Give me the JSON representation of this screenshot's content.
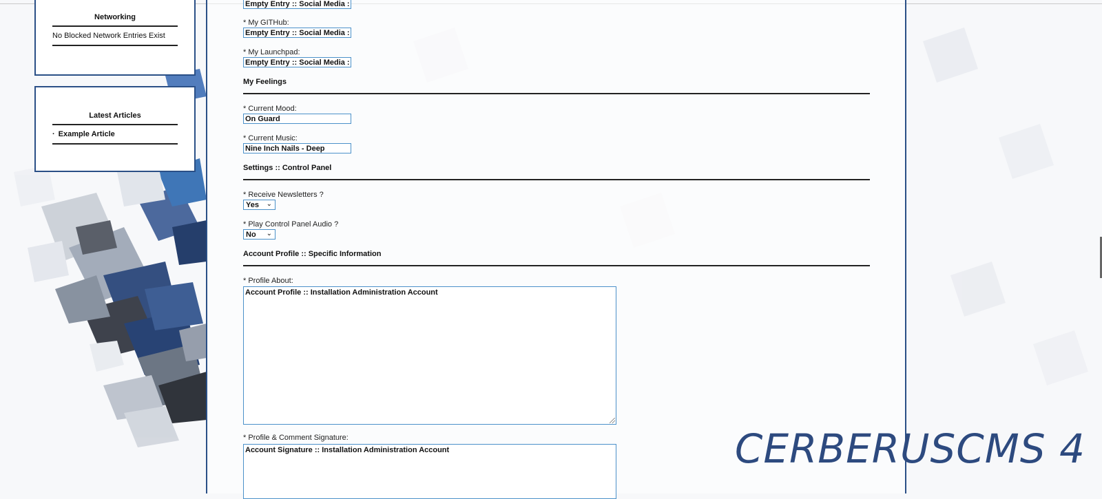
{
  "sidebar": {
    "networking": {
      "title": "Networking",
      "entry": "No Blocked Network Entries Exist"
    },
    "articles": {
      "title": "Latest Articles",
      "items": [
        {
          "bullet": "·",
          "label": "Example Article"
        }
      ]
    }
  },
  "form": {
    "social_prev": {
      "value": "Empty Entry :: Social Media :"
    },
    "github": {
      "label": "* My GITHub:",
      "value": "Empty Entry :: Social Media :"
    },
    "launchpad": {
      "label": "* My Launchpad:",
      "value": "Empty Entry :: Social Media :"
    },
    "feelings_title": "My Feelings",
    "mood": {
      "label": "* Current Mood:",
      "value": "On Guard"
    },
    "music": {
      "label": "* Current Music:",
      "value": "Nine Inch Nails - Deep"
    },
    "settings_title": "Settings :: Control Panel",
    "newsletters": {
      "label": "* Receive Newsletters ?",
      "value": "Yes"
    },
    "audio": {
      "label": "* Play Control Panel Audio ?",
      "value": "No"
    },
    "profile_title": "Account Profile :: Specific Information",
    "about": {
      "label": "* Profile About:",
      "value": "Account Profile :: Installation Administration Account"
    },
    "signature": {
      "label": "* Profile & Comment Signature:",
      "value": "Account Signature :: Installation Administration Account"
    }
  },
  "brand": "CERBERUSCMS 4",
  "colors": {
    "accent": "#2a4f86",
    "input_border": "#4a90c9",
    "brand": "#2d4a7f"
  },
  "icons": {
    "select_chevron": "chevron-down-icon",
    "resize": "resize-grip-icon"
  }
}
